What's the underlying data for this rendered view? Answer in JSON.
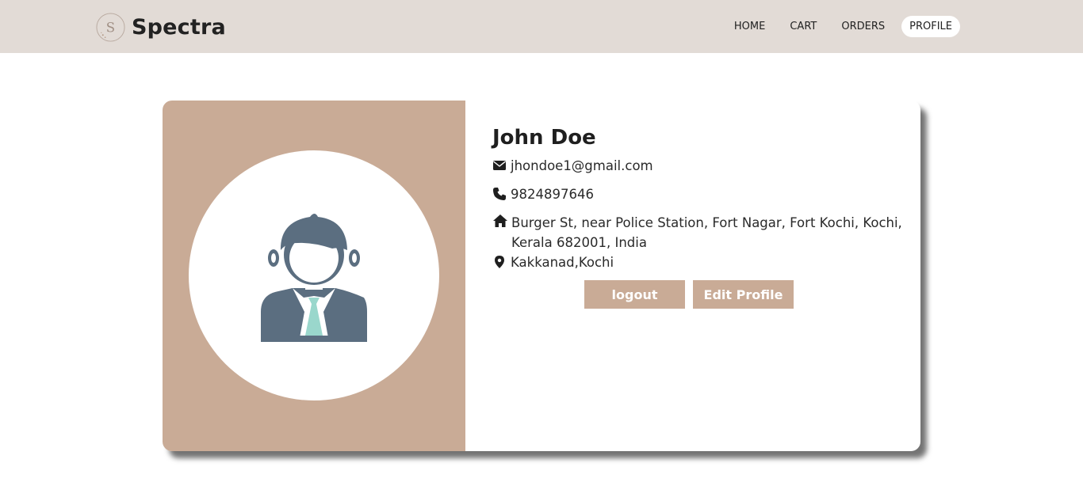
{
  "brand": {
    "name": "Spectra",
    "logo_letter": "S"
  },
  "nav": {
    "items": [
      "HOME",
      "CART",
      "ORDERS",
      "PROFILE"
    ],
    "active": "PROFILE"
  },
  "profile": {
    "name": "John Doe",
    "email": "jhondoe1@gmail.com",
    "phone": "9824897646",
    "address": "Burger St, near Police Station, Fort Nagar, Fort Kochi, Kochi, Kerala 682001, India",
    "location": "Kakkanad,Kochi"
  },
  "actions": {
    "logout_label": "logout",
    "edit_label": "Edit Profile"
  },
  "icons": {
    "email": "envelope-icon",
    "phone": "phone-icon",
    "address": "home-icon",
    "location": "map-pin-icon"
  },
  "colors": {
    "navbar_bg": "#e2dbd6",
    "accent": "#c9ab96",
    "avatar_body": "#5b6e80",
    "tie": "#9ad7cc"
  }
}
